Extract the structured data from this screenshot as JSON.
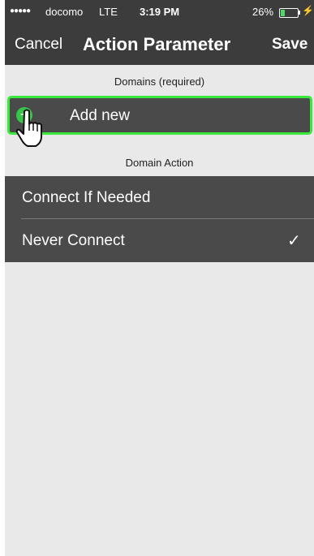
{
  "status_bar": {
    "signal": "●●●●●",
    "carrier": "docomo",
    "network": "LTE",
    "time": "3:19 PM",
    "battery_percent": "26%",
    "battery_level": 0.26
  },
  "nav": {
    "cancel_label": "Cancel",
    "title": "Action Parameter",
    "save_label": "Save"
  },
  "domains_section": {
    "header": "Domains (required)",
    "add_label": "Add new",
    "add_icon": "plus-circle-icon"
  },
  "domain_action_section": {
    "header": "Domain Action",
    "options": [
      {
        "label": "Connect If Needed",
        "selected": false
      },
      {
        "label": "Never Connect",
        "selected": true
      }
    ],
    "check_mark": "✓"
  },
  "colors": {
    "bar_background": "#3c3c3c",
    "row_background": "#4a4a4a",
    "highlight_border": "#39e83a",
    "add_icon": "#35c64a"
  }
}
